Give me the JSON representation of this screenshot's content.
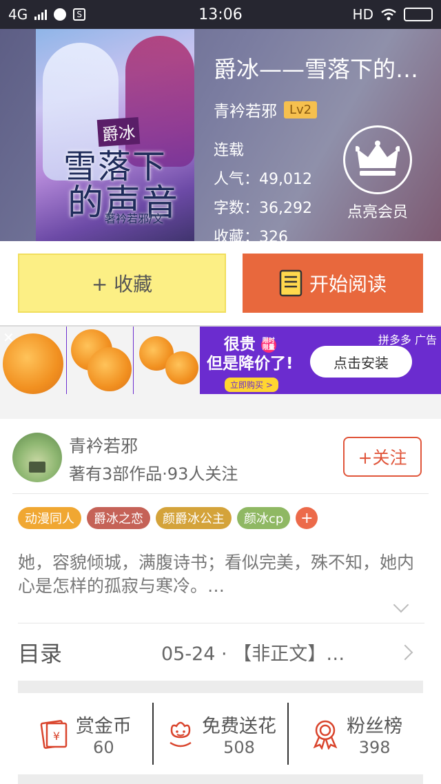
{
  "status_bar": {
    "network": "4G",
    "time": "13:06",
    "hd": "HD"
  },
  "book": {
    "title": "爵冰——雪落下的…",
    "author": "青衿若邪",
    "level": "Lv2",
    "status": "连载",
    "popularity": "人气：49,012",
    "words": "字数：36,292",
    "favorites": "收藏：326",
    "member_label": "点亮会员"
  },
  "cover": {
    "badge": "爵冰",
    "line1": "雪落下",
    "line2": "的声音",
    "byline": "著衿若邪/文"
  },
  "actions": {
    "favorite": "+ 收藏",
    "read": "开始阅读"
  },
  "ad": {
    "close": "✕",
    "slogan_line1": "很贵",
    "hot_badge": "限时 限量",
    "slogan_line2": "但是降价了!",
    "buy_now": "立即购买 >",
    "install": "点击安装",
    "tag": "拼多多  广告"
  },
  "author_card": {
    "name": "青衿若邪",
    "summary": "著有3部作品·93人关注",
    "follow": "+关注"
  },
  "tags": [
    {
      "label": "动漫同人",
      "color": "#f0a732"
    },
    {
      "label": "爵冰之恋",
      "color": "#c56257"
    },
    {
      "label": "颜爵冰公主",
      "color": "#d4a33a"
    },
    {
      "label": "颜冰cp",
      "color": "#8fb863"
    }
  ],
  "tag_more": "+",
  "description": "她，容貌倾城，满腹诗书；看似完美，殊不知，她内心是怎样的孤寂与寒冷。…",
  "toc": {
    "label": "目录",
    "latest": "05-24 · 【非正文】…"
  },
  "stats": [
    {
      "label": "赏金币",
      "value": "60",
      "icon": "red-envelope-icon"
    },
    {
      "label": "免费送花",
      "value": "508",
      "icon": "flower-icon"
    },
    {
      "label": "粉丝榜",
      "value": "398",
      "icon": "medal-icon"
    }
  ],
  "colors": {
    "accent": "#e0553a",
    "read_button": "#e8683d",
    "favorite_button": "#fcef85",
    "ad_background": "#6b2ccf"
  }
}
